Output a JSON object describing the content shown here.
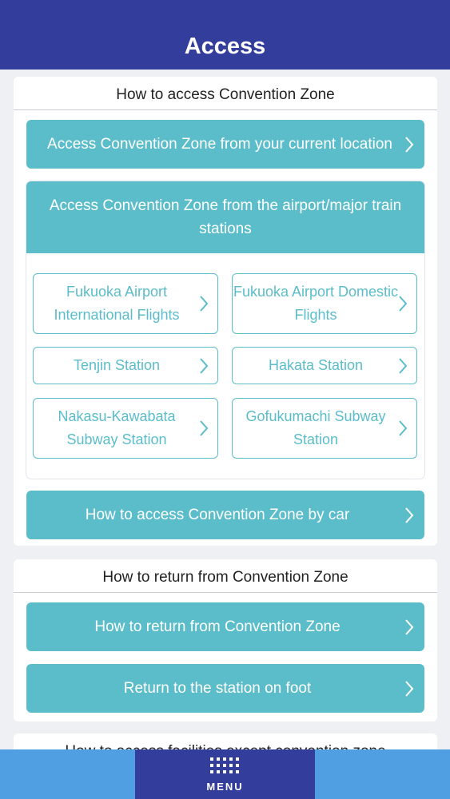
{
  "header": {
    "title": "Access"
  },
  "access_section": {
    "title": "How to access Convention Zone",
    "current_location_label": "Access Convention Zone from your current location",
    "airport_panel": {
      "title": "Access Convention Zone from the airport/major train stations",
      "stations": [
        {
          "label": "Fukuoka Airport International Flights"
        },
        {
          "label": "Fukuoka Airport Domestic Flights"
        },
        {
          "label": "Tenjin Station"
        },
        {
          "label": "Hakata Station"
        },
        {
          "label": "Nakasu-Kawabata Subway Station"
        },
        {
          "label": "Gofukumachi Subway Station"
        }
      ]
    },
    "by_car_label": "How to access Convention Zone by car"
  },
  "return_section": {
    "title": "How to return from Convention Zone",
    "return_label": "How to return from Convention Zone",
    "on_foot_label": "Return to the station on foot"
  },
  "facilities_section": {
    "title": "How to access facilities except convention zone"
  },
  "bottom_nav": {
    "menu_label": "MENU",
    "menu_icon": "grid-menu-icon"
  },
  "colors": {
    "header": "#333e9c",
    "accent": "#5bbdca",
    "menu_bg": "#333e9c",
    "bottom_bar": "#4f9fe2",
    "page_bg": "#eef0f3"
  }
}
